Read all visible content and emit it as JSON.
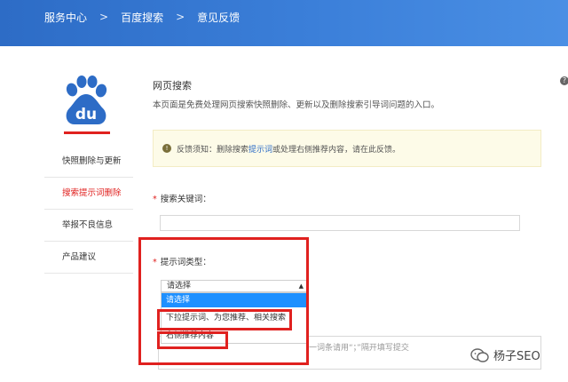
{
  "breadcrumb": [
    "服务中心",
    "百度搜索",
    "意见反馈"
  ],
  "breadcrumb_sep": ">",
  "logo": {
    "text": "du",
    "color": "#2d6cc6",
    "accent": "#e0211f"
  },
  "sidebar": {
    "items": [
      {
        "label": "快照删除与更新",
        "active": false
      },
      {
        "label": "搜索提示词删除",
        "active": true
      },
      {
        "label": "举报不良信息",
        "active": false
      },
      {
        "label": "产品建议",
        "active": false
      }
    ]
  },
  "section": {
    "title": "网页搜索",
    "desc": "本页面是免费处理网页搜索快照删除、更新以及删除搜索引导词问题的入口。"
  },
  "notice": {
    "prefix": "反馈须知：删除搜索",
    "link": "提示词",
    "suffix": "或处理右侧推荐内容，请在此反馈。"
  },
  "form": {
    "keyword_label": "搜索关键词：",
    "type_label": "提示词类型：",
    "required_mark": "*",
    "select_value": "请选择",
    "options": [
      "请选择",
      "下拉提示词、为您推荐、相关搜索",
      "右侧推荐内容"
    ],
    "hint": "一词条请用“；”隔开填写提交"
  },
  "watermark": {
    "text": "杨子SEO"
  },
  "colors": {
    "header": "#2d6cc6",
    "accent_red": "#e0211f",
    "select_highlight": "#1e90ff"
  }
}
